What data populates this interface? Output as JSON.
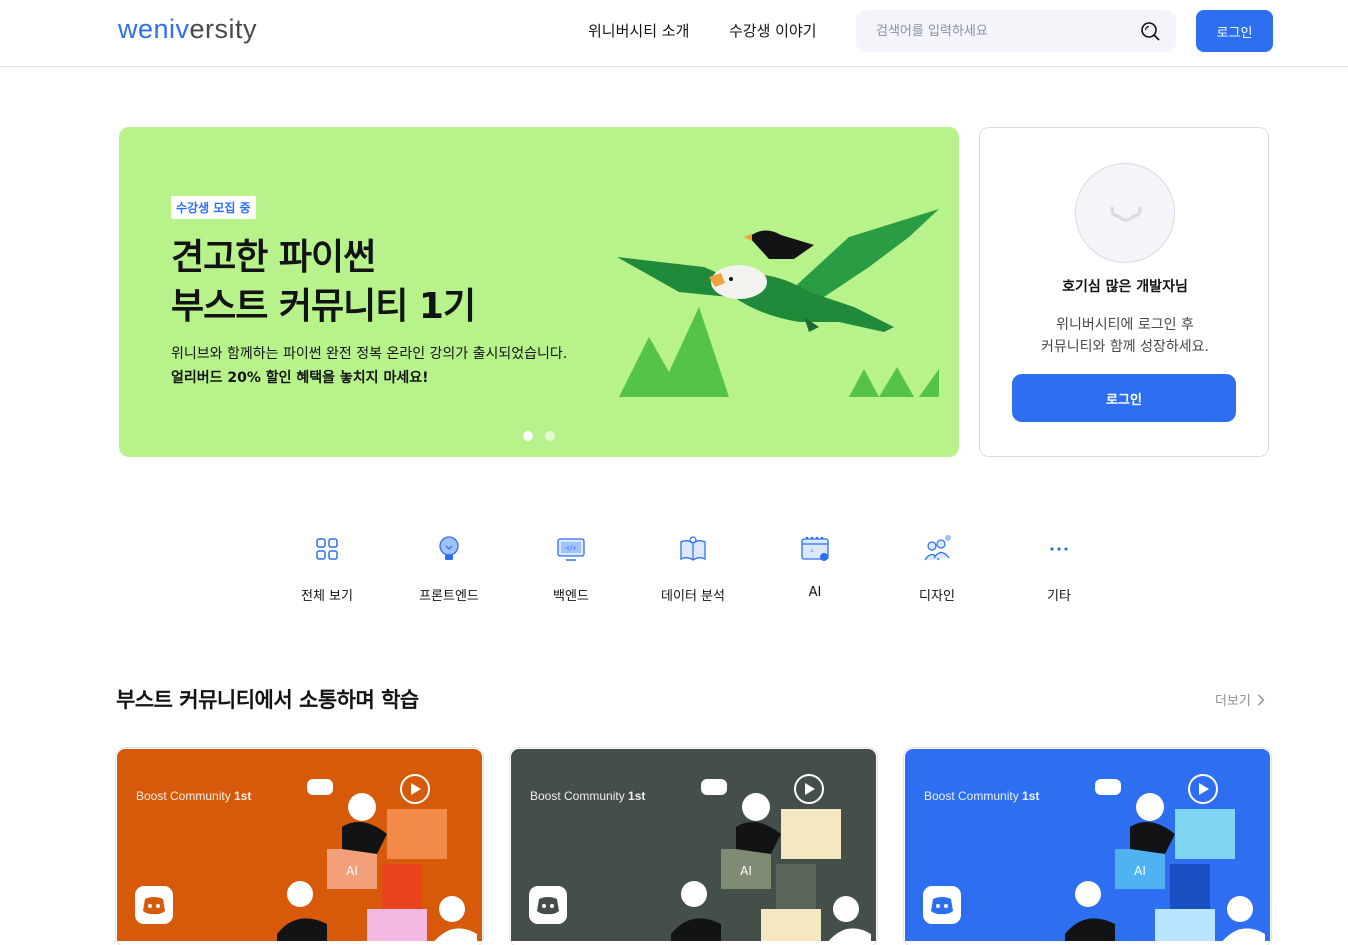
{
  "header": {
    "logo_part1": "weniv",
    "logo_part2": "ersity",
    "nav": [
      "위니버시티 소개",
      "수강생 이야기"
    ],
    "search_placeholder": "검색어를 입력하세요",
    "login_label": "로그인"
  },
  "banner": {
    "badge": "수강생 모집 중",
    "title_line1": "견고한 파이썬",
    "title_line2": "부스트 커뮤니티 1기",
    "desc": "위니브와 함께하는 파이썬 완전 정복 온라인 강의가 출시되었습니다.",
    "desc_bold": "얼리버드 20% 할인 혜택을 놓치지 마세요!",
    "slides_total": 2,
    "slide_active": 1,
    "bg_color": "#b8f28a"
  },
  "profile": {
    "name": "호기심 많은 개발자님",
    "desc_line1": "위니버시티에 로그인 후",
    "desc_line2": "커뮤니티와 함께 성장하세요.",
    "login_label": "로그인"
  },
  "categories": [
    {
      "label": "전체 보기",
      "icon": "grid-icon"
    },
    {
      "label": "프론트엔드",
      "icon": "lightbulb-icon"
    },
    {
      "label": "백엔드",
      "icon": "monitor-code-icon"
    },
    {
      "label": "데이터 분석",
      "icon": "book-icon"
    },
    {
      "label": "AI",
      "icon": "calendar-ai-icon"
    },
    {
      "label": "디자인",
      "icon": "people-icon"
    },
    {
      "label": "기타",
      "icon": "more-dots-icon"
    }
  ],
  "section": {
    "title": "부스트 커뮤니티에서 소통하며 학습",
    "more_label": "더보기"
  },
  "cards": [
    {
      "label_normal": "Boost Community ",
      "label_bold": "1st",
      "bg": "#d65a0a"
    },
    {
      "label_normal": "Boost Community ",
      "label_bold": "1st",
      "bg": "#454f4a"
    },
    {
      "label_normal": "Boost Community ",
      "label_bold": "1st",
      "bg": "#2e6ff2"
    }
  ],
  "colors": {
    "primary": "#2e6ff2",
    "text": "#121314",
    "muted": "#8d9299"
  }
}
